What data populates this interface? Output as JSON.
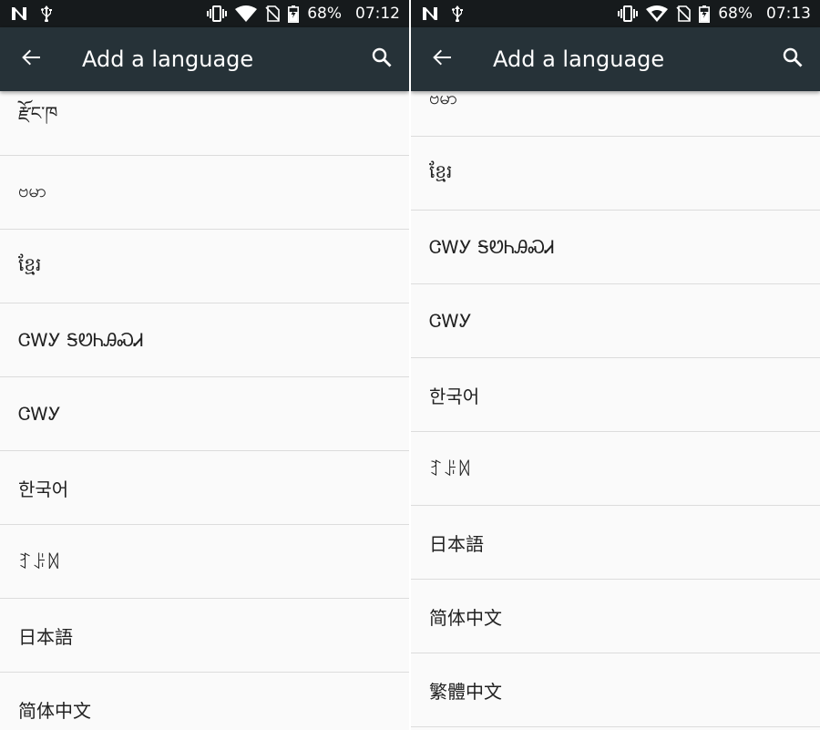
{
  "left_screen": {
    "status": {
      "battery": "68%",
      "time": "07:12"
    },
    "toolbar": {
      "title": "Add a language"
    },
    "languages": [
      "རྫོང་ཁ",
      "ဗမာ",
      "ខ្មែរ",
      "ᏣᎳᎩ ᎦᏬᏂᎯᏍᏗ",
      "ᏣᎳᎩ",
      "한국어",
      "ꆈꌠꉙ",
      "日本語",
      "简体中文"
    ]
  },
  "right_screen": {
    "status": {
      "battery": "68%",
      "time": "07:13"
    },
    "toolbar": {
      "title": "Add a language"
    },
    "languages": [
      "ဗမာ",
      "ខ្មែរ",
      "ᏣᎳᎩ ᎦᏬᏂᎯᏍᏗ",
      "ᏣᎳᎩ",
      "한국어",
      "ꆈꌠꉙ",
      "日本語",
      "简体中文",
      "繁體中文"
    ]
  },
  "colors": {
    "status_bar": "#161a1c",
    "toolbar": "#263238",
    "list_bg": "#fafafa",
    "divider": "#dcdcdc",
    "text": "#212121"
  },
  "icons": [
    "n-notification-icon",
    "usb-icon",
    "vibrate-icon",
    "wifi-icon",
    "no-sim-icon",
    "battery-charging-icon",
    "back-arrow-icon",
    "search-icon"
  ]
}
